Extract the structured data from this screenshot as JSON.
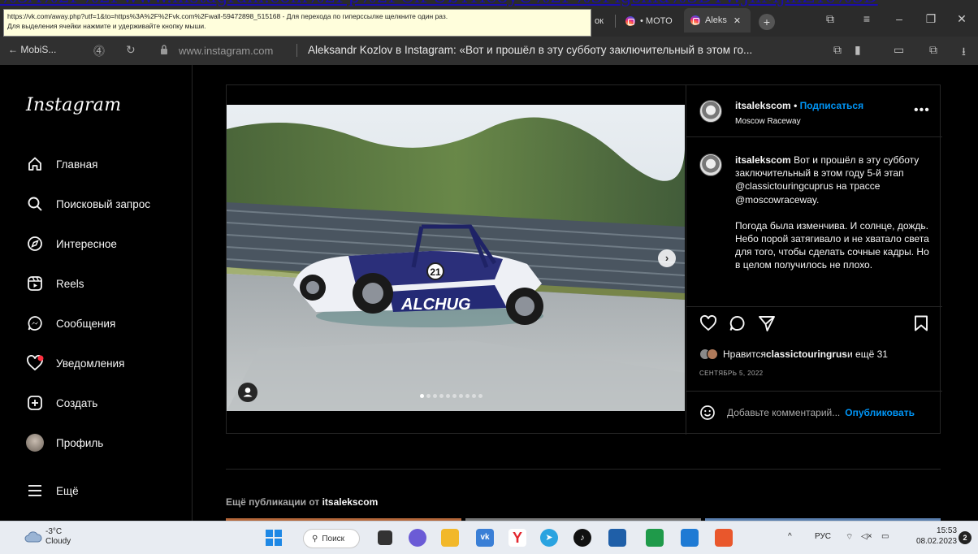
{
  "overflow_link": "%3A%2F%2Fwww.instagram.com%2Fp%2FCiFUbYHe8yU%2F%3Figshid%3DYWJhMjlhZTc%3D",
  "tooltip": {
    "line1": "https://vk.com/away.php?utf=1&to=https%3A%2F%2Fvk.com%2Fwall-59472898_515168 - Для перехода по гиперссылке щелкните один раз.",
    "line2": "Для выделения ячейки нажмите и удерживайте кнопку мыши."
  },
  "tabs": [
    {
      "label": "ок"
    },
    {
      "label": "• MOTO"
    },
    {
      "label": "Aleks"
    }
  ],
  "address_bar": {
    "back_label": "← MobiS...",
    "domain": "www.instagram.com",
    "title": "Aleksandr Kozlov в Instagram: «Вот и прошёл в эту субботу заключительный в этом го..."
  },
  "sidebar": {
    "logo": "Instagram",
    "items": [
      {
        "label": "Главная",
        "icon": "home-icon"
      },
      {
        "label": "Поисковый запрос",
        "icon": "search-icon"
      },
      {
        "label": "Интересное",
        "icon": "compass-icon"
      },
      {
        "label": "Reels",
        "icon": "reels-icon"
      },
      {
        "label": "Сообщения",
        "icon": "messenger-icon"
      },
      {
        "label": "Уведомления",
        "icon": "heart-icon"
      },
      {
        "label": "Создать",
        "icon": "plus-square-icon"
      },
      {
        "label": "Профиль",
        "icon": "avatar"
      },
      {
        "label": "Ещё",
        "icon": "menu-icon"
      }
    ]
  },
  "post": {
    "username": "itsalekscom",
    "follow_label": "Подписаться",
    "location": "Moscow Raceway",
    "more_label": "•••",
    "caption_user": "itsalekscom",
    "caption_p1": "Вот и прошёл в эту субботу заключительный в этом году 5-й этап @classictouringcuprus на трассе @moscowraceway.",
    "caption_p2": "Погода была изменчива. И солнце, дождь. Небо порой затягивало и не хватало света для того, чтобы сделать сочные кадры. Но в целом получилось не плохо.",
    "likes_prefix": "Нравится ",
    "likes_user": "classictouringrus",
    "likes_suffix": " и ещё 31",
    "date": "СЕНТЯБРЬ 5, 2022",
    "comment_placeholder": "Добавьте комментарий...",
    "publish_label": "Опубликовать",
    "car_number": "21",
    "car_text": "ALCHUG",
    "carousel_current": 1,
    "carousel_total": 10
  },
  "more_posts": {
    "prefix": "Ещё публикации от ",
    "user": "itsalekscom"
  },
  "taskbar": {
    "temp": "-3°C",
    "weather": "Cloudy",
    "search_label": "Поиск",
    "lang": "РУС",
    "time": "15:53",
    "date": "08.02.2023",
    "notif_count": "2",
    "tray_chevron": "^"
  },
  "colors": {
    "accent_blue": "#0095f6",
    "notification_red": "#ff3040",
    "page_bg": "#000000"
  }
}
